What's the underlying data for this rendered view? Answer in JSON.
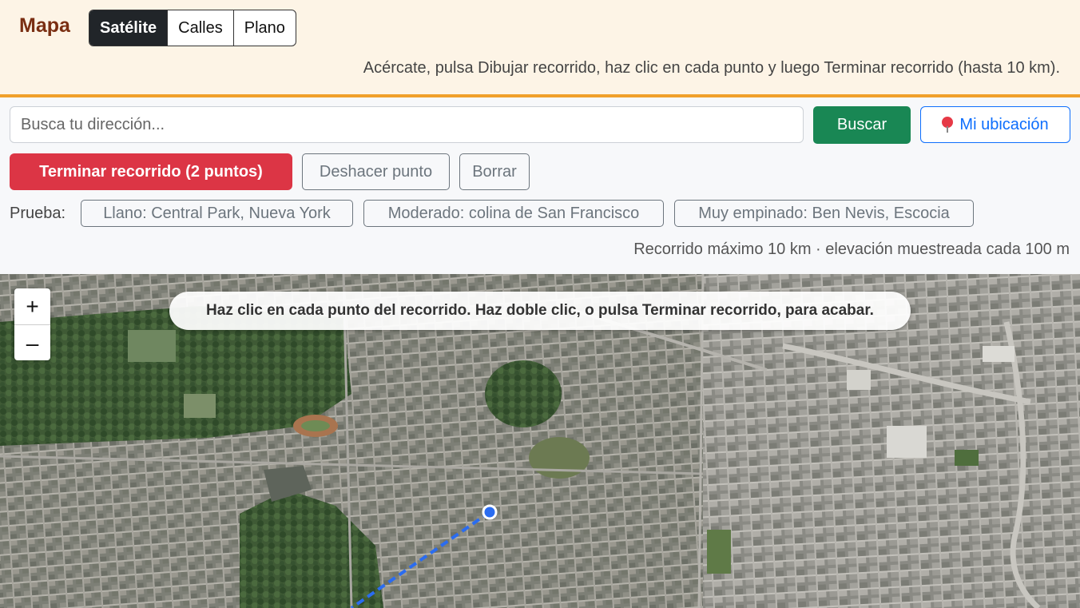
{
  "header": {
    "title": "Mapa",
    "map_types": [
      {
        "label": "Satélite",
        "active": true
      },
      {
        "label": "Calles",
        "active": false
      },
      {
        "label": "Plano",
        "active": false
      }
    ],
    "instruction": "Acércate, pulsa Dibujar recorrido, haz clic en cada punto y luego Terminar recorrido (hasta 10 km)."
  },
  "search": {
    "placeholder": "Busca tu dirección...",
    "value": "",
    "search_label": "Buscar",
    "location_label": "Mi ubicación",
    "location_icon": "map-pin-icon"
  },
  "route": {
    "finish_label": "Terminar recorrido (2 puntos)",
    "undo_label": "Deshacer punto",
    "clear_label": "Borrar"
  },
  "examples": {
    "label": "Prueba:",
    "items": [
      "Llano: Central Park, Nueva York",
      "Moderado: colina de San Francisco",
      "Muy empinado: Ben Nevis, Escocia"
    ]
  },
  "limits": "Recorrido máximo 10 km · elevación muestreada cada 100 m",
  "map": {
    "zoom_in": "+",
    "zoom_out": "–",
    "tooltip": "Haz clic en cada punto del recorrido. Haz doble clic, o pulsa Terminar recorrido, para acabar.",
    "route_color": "#2a6cf0",
    "imagery": "satellite"
  },
  "colors": {
    "accent": "#f0a02a",
    "brand": "#7a2e12",
    "success": "#198754",
    "danger": "#dc3545",
    "primary": "#0d6efd"
  }
}
